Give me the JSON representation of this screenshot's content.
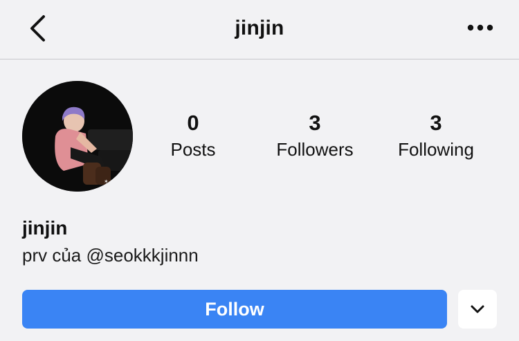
{
  "header": {
    "title": "jinjin",
    "back_icon": "chevron-left-icon",
    "more_icon": "more-horizontal-icon"
  },
  "stats": [
    {
      "value": "0",
      "label": "Posts"
    },
    {
      "value": "3",
      "label": "Followers"
    },
    {
      "value": "3",
      "label": "Following"
    }
  ],
  "profile": {
    "name": "jinjin",
    "bio": "prv của @seokkkjinnn"
  },
  "actions": {
    "follow_label": "Follow",
    "dropdown_icon": "chevron-down-icon"
  },
  "colors": {
    "background": "#f2f2f4",
    "accent": "#3a84f4"
  }
}
